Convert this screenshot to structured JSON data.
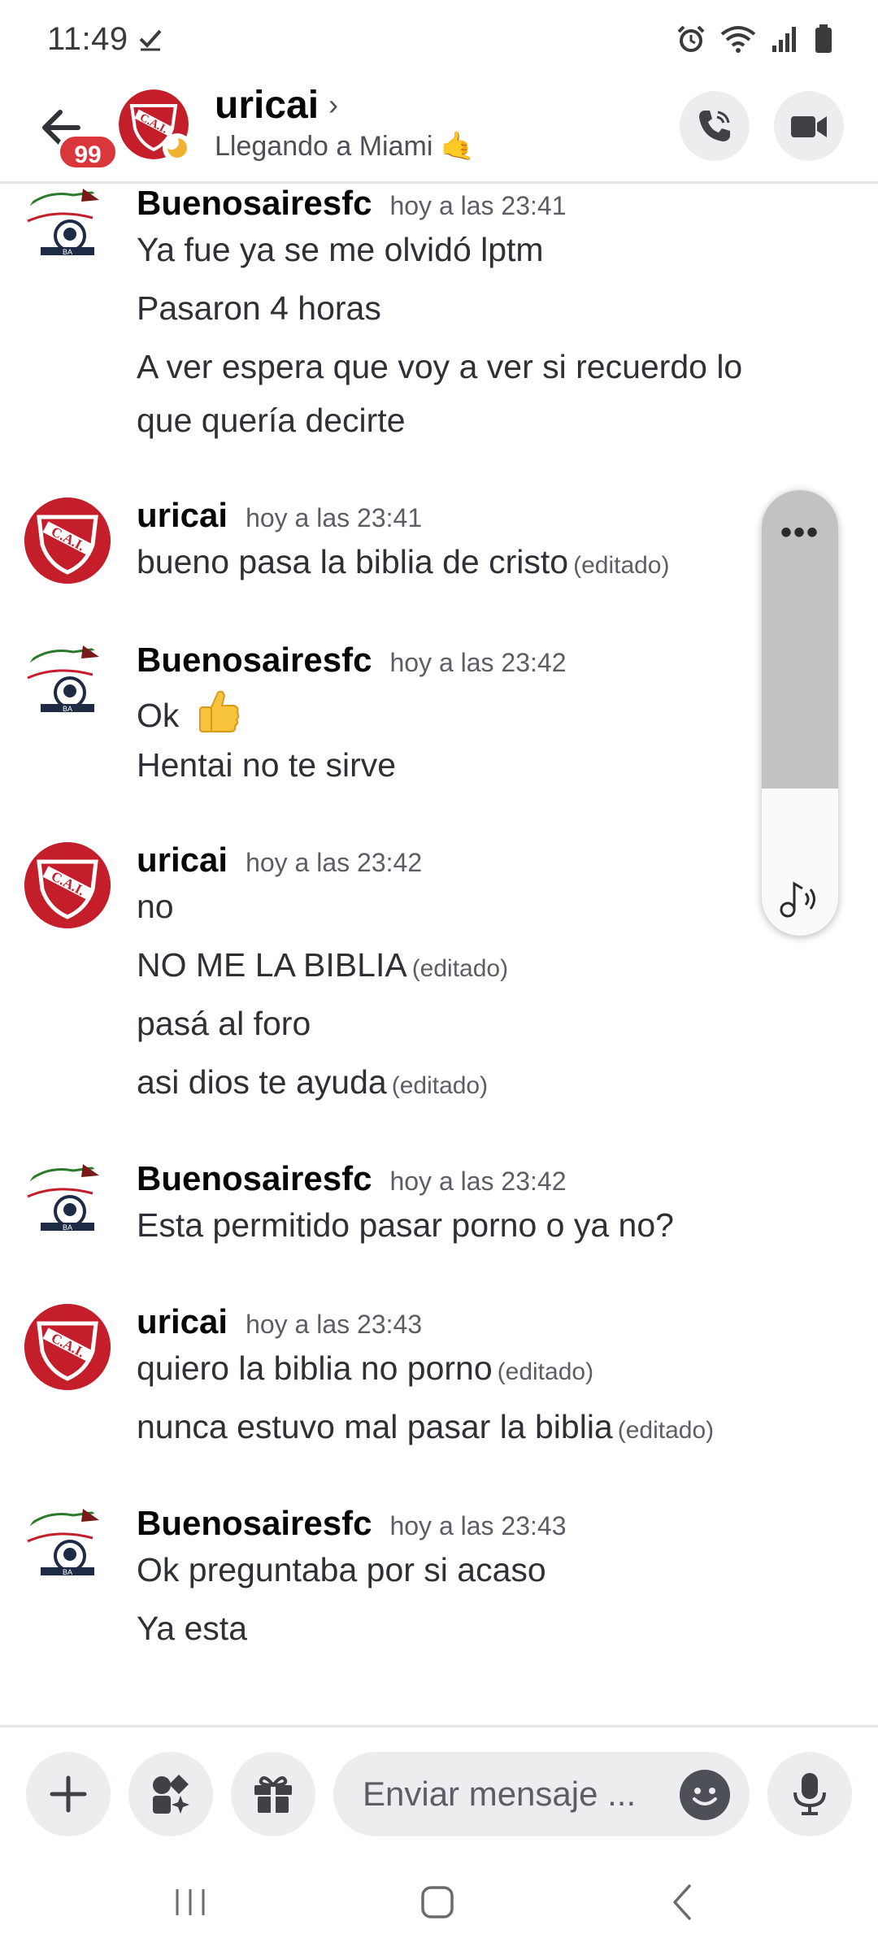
{
  "status_bar": {
    "time": "11:49"
  },
  "header": {
    "back_label": "back",
    "unread_count": "99",
    "name": "uricai",
    "chevron": "›",
    "custom_status": "Llegando a Miami 🤙"
  },
  "messages": [
    {
      "author": "Buenosairesfc",
      "time": "hoy a las 23:41",
      "lines": [
        {
          "text": "Ya fue ya se me olvidó lptm"
        },
        {
          "text": "Pasaron 4 horas"
        },
        {
          "text": "A ver espera que voy a ver si recuerdo lo"
        },
        {
          "text": "que quería decirte"
        }
      ]
    },
    {
      "author": "uricai",
      "time": "hoy a las 23:41",
      "lines": [
        {
          "text": "bueno pasa la biblia de cristo",
          "edited": "(editado)"
        }
      ]
    },
    {
      "author": "Buenosairesfc",
      "time": "hoy a las 23:42",
      "lines": [
        {
          "text": "Ok"
        },
        {
          "text": "Hentai no te sirve"
        }
      ]
    },
    {
      "author": "uricai",
      "time": "hoy a las 23:42",
      "lines": [
        {
          "text": "no"
        },
        {
          "text": "NO ME LA BIBLIA",
          "edited": "(editado)"
        },
        {
          "text": "pasá al foro"
        },
        {
          "text": "asi dios te ayuda",
          "edited": "(editado)"
        }
      ]
    },
    {
      "author": "Buenosairesfc",
      "time": "hoy a las 23:42",
      "lines": [
        {
          "text": "Esta permitido pasar porno o ya no?"
        }
      ]
    },
    {
      "author": "uricai",
      "time": "hoy a las 23:43",
      "lines": [
        {
          "text": "quiero la biblia no porno",
          "edited": "(editado)"
        },
        {
          "text": "nunca estuvo mal pasar la biblia",
          "edited": "(editado)"
        }
      ]
    },
    {
      "author": "Buenosairesfc",
      "time": "hoy a las 23:43",
      "lines": [
        {
          "text": "Ok preguntaba por si acaso"
        },
        {
          "text": "Ya esta"
        }
      ]
    }
  ],
  "audio_widget": {
    "more_label": "•••",
    "level": 0.67
  },
  "composer": {
    "placeholder": "Enviar mensaje ..."
  },
  "colors": {
    "accent_red": "#da373c",
    "cai_red": "#c41e2a",
    "idle_yellow": "#f0b232",
    "button_bg": "#ebedef"
  },
  "icons": [
    "check-icon",
    "alarm-icon",
    "wifi-icon",
    "signal-icon",
    "battery-icon",
    "back-arrow-icon",
    "phone-icon",
    "video-camera-icon",
    "plus-icon",
    "apps-icon",
    "gift-icon",
    "emoji-icon",
    "microphone-icon",
    "music-note-icon",
    "recents-icon",
    "home-icon",
    "nav-back-icon"
  ]
}
